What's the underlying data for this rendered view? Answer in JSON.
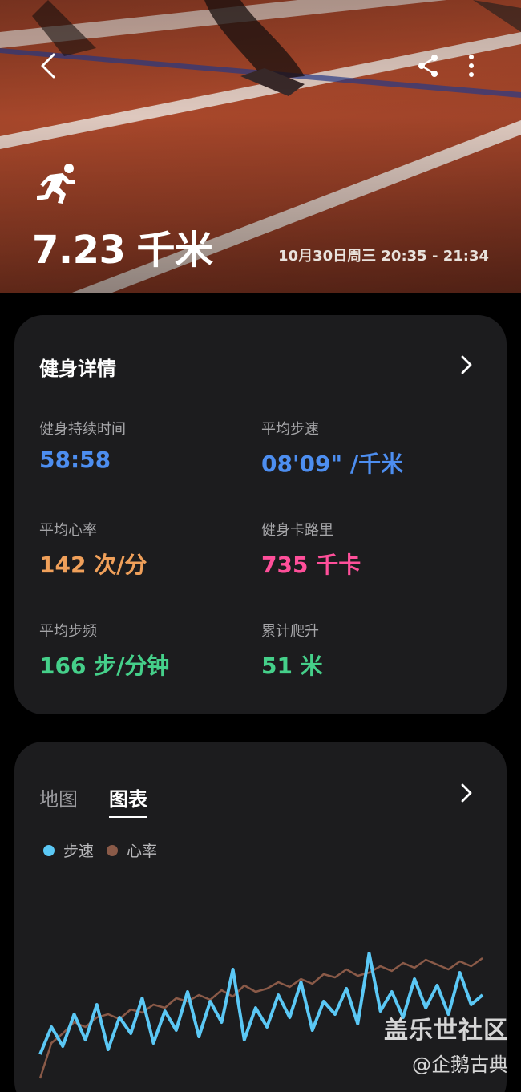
{
  "hero": {
    "distance_value": "7.23",
    "distance_unit": "千米",
    "time_range": "10月30日周三 20:35 - 21:34"
  },
  "details": {
    "title": "健身详情",
    "stats": [
      {
        "label": "健身持续时间",
        "value": "58:58",
        "color": "#4d8ef0"
      },
      {
        "label": "平均步速",
        "value": "08'09\" /千米",
        "color": "#4d8ef0"
      },
      {
        "label": "平均心率",
        "value": "142 次/分",
        "color": "#f0a05a"
      },
      {
        "label": "健身卡路里",
        "value": "735 千卡",
        "color": "#ff4f9a"
      },
      {
        "label": "平均步频",
        "value": "166 步/分钟",
        "color": "#45d08a"
      },
      {
        "label": "累计爬升",
        "value": "51 米",
        "color": "#45d08a"
      }
    ]
  },
  "chart_card": {
    "tabs": [
      "地图",
      "图表"
    ],
    "active_tab": "图表",
    "legend": [
      {
        "name": "步速",
        "color": "#5bc8f5"
      },
      {
        "name": "心率",
        "color": "#8a5a48"
      }
    ]
  },
  "chart_data": {
    "type": "line",
    "title": "",
    "xlabel": "",
    "ylabel": "",
    "series": [
      {
        "name": "心率",
        "values": [
          20,
          42,
          48,
          55,
          52,
          58,
          60,
          57,
          63,
          61,
          66,
          64,
          70,
          68,
          72,
          69,
          75,
          71,
          78,
          74,
          76,
          80,
          77,
          82,
          79,
          85,
          83,
          88,
          84,
          86,
          90,
          87,
          92,
          89,
          94,
          91,
          88,
          93,
          90,
          95
        ]
      },
      {
        "name": "步速",
        "values": [
          35,
          52,
          40,
          60,
          44,
          66,
          38,
          58,
          48,
          70,
          42,
          62,
          50,
          74,
          46,
          68,
          55,
          88,
          44,
          64,
          52,
          72,
          58,
          80,
          50,
          68,
          60,
          76,
          54,
          98,
          62,
          74,
          58,
          82,
          64,
          78,
          60,
          86,
          66,
          72
        ]
      }
    ]
  },
  "watermark": {
    "line1": "盖乐世社区",
    "line2": "@企鹅古典"
  }
}
